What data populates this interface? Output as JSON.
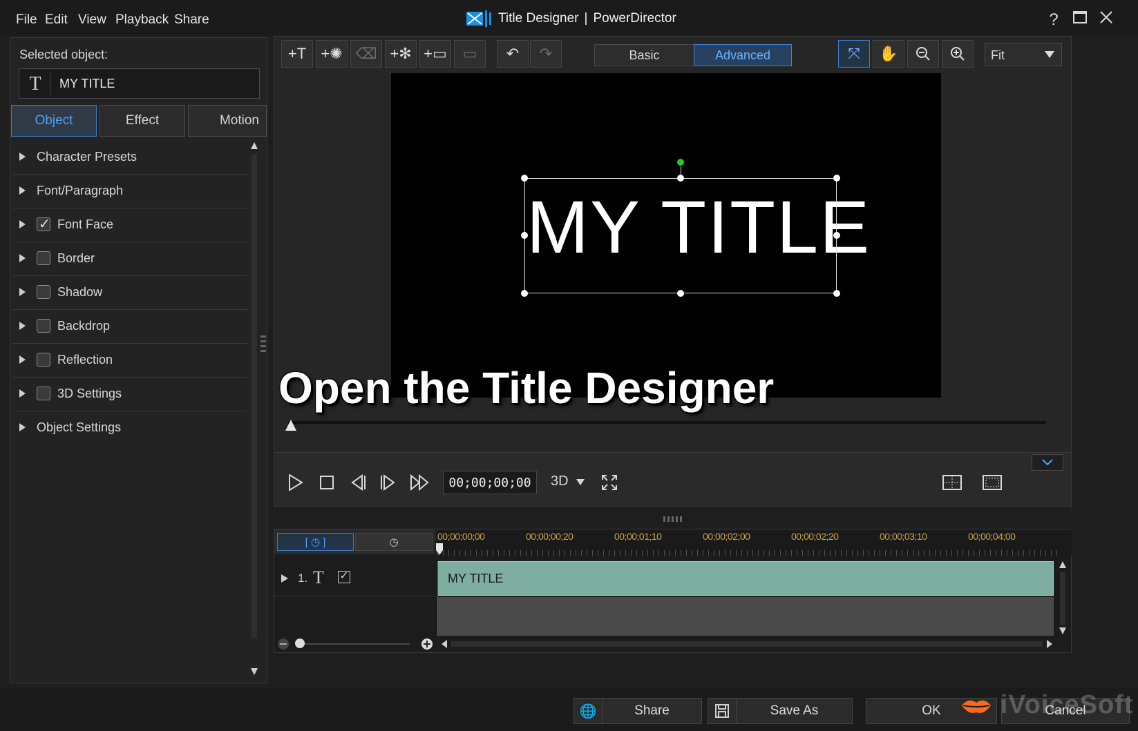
{
  "menu": [
    "File",
    "Edit",
    "View",
    "Playback",
    "Share"
  ],
  "window": {
    "title_app": "Title Designer",
    "title_sep": "|",
    "title_product": "PowerDirector",
    "help": "?"
  },
  "left_panel": {
    "selected_label": "Selected object:",
    "selected_value": "MY TITLE",
    "tabs": [
      "Object",
      "Effect",
      "Motion"
    ],
    "active_tab": "Object",
    "sections": [
      {
        "label": "Character Presets",
        "checkbox": false
      },
      {
        "label": "Font/Paragraph",
        "checkbox": false
      },
      {
        "label": "Font Face",
        "checkbox": true,
        "checked": true
      },
      {
        "label": "Border",
        "checkbox": true,
        "checked": false
      },
      {
        "label": "Shadow",
        "checkbox": true,
        "checked": false
      },
      {
        "label": "Backdrop",
        "checkbox": true,
        "checked": false
      },
      {
        "label": "Reflection",
        "checkbox": true,
        "checked": false
      },
      {
        "label": "3D Settings",
        "checkbox": true,
        "checked": false
      },
      {
        "label": "Object Settings",
        "checkbox": false
      }
    ]
  },
  "toolbar": {
    "mode_basic": "Basic",
    "mode_advanced": "Advanced",
    "zoom_value": "Fit"
  },
  "canvas": {
    "title_text": "MY TITLE"
  },
  "overlay": {
    "caption": "Open the Title Designer"
  },
  "playback": {
    "timecode": "00;00;00;00",
    "mode": "3D"
  },
  "timeline": {
    "ticks": [
      "00;00;00;00",
      "00;00;00;20",
      "00;00;01;10",
      "00;00;02;00",
      "00;00;02;20",
      "00;00;03;10",
      "00;00;04;00"
    ],
    "track_number": "1.",
    "clip_label": "MY TITLE"
  },
  "bottom": {
    "share": "Share",
    "save_as": "Save As",
    "ok": "OK",
    "cancel": "Cancel"
  },
  "watermark": "iVoiceSoft",
  "colors": {
    "accent": "#3a86d8",
    "clip": "#7eaea0",
    "rotate_handle": "#22cc22",
    "timecode_ticks": "#c9a34a"
  }
}
